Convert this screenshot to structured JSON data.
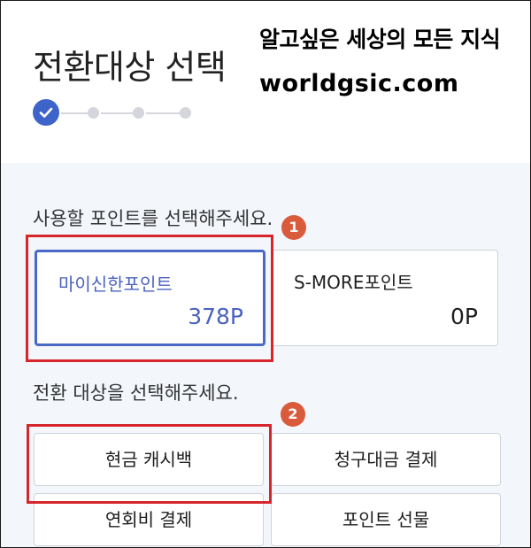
{
  "header": {
    "title": "전환대상 선택",
    "steps": [
      {
        "state": "complete",
        "icon": "check-icon"
      },
      {
        "state": "pending"
      },
      {
        "state": "pending"
      },
      {
        "state": "pending"
      }
    ]
  },
  "watermark": {
    "line1": "알고싶은 세상의 모든 지식",
    "line2": "worldgsic.com"
  },
  "points": {
    "label": "사용할 포인트를 선택해주세요.",
    "options": [
      {
        "name": "마이신한포인트",
        "value": "378P",
        "selected": true
      },
      {
        "name": "S-MORE포인트",
        "value": "0P",
        "selected": false
      }
    ]
  },
  "targets": {
    "label": "전환 대상을 선택해주세요.",
    "options": [
      {
        "label": "현금 캐시백"
      },
      {
        "label": "청구대금 결제"
      },
      {
        "label": "연회비 결제"
      },
      {
        "label": "포인트 선물"
      }
    ]
  },
  "annotations": {
    "badge1": "1",
    "badge2": "2",
    "highlight_color": "#d6262b",
    "badge_color": "#d95b3c"
  },
  "colors": {
    "accent": "#3e63c9",
    "background": "#f3f6fb"
  }
}
